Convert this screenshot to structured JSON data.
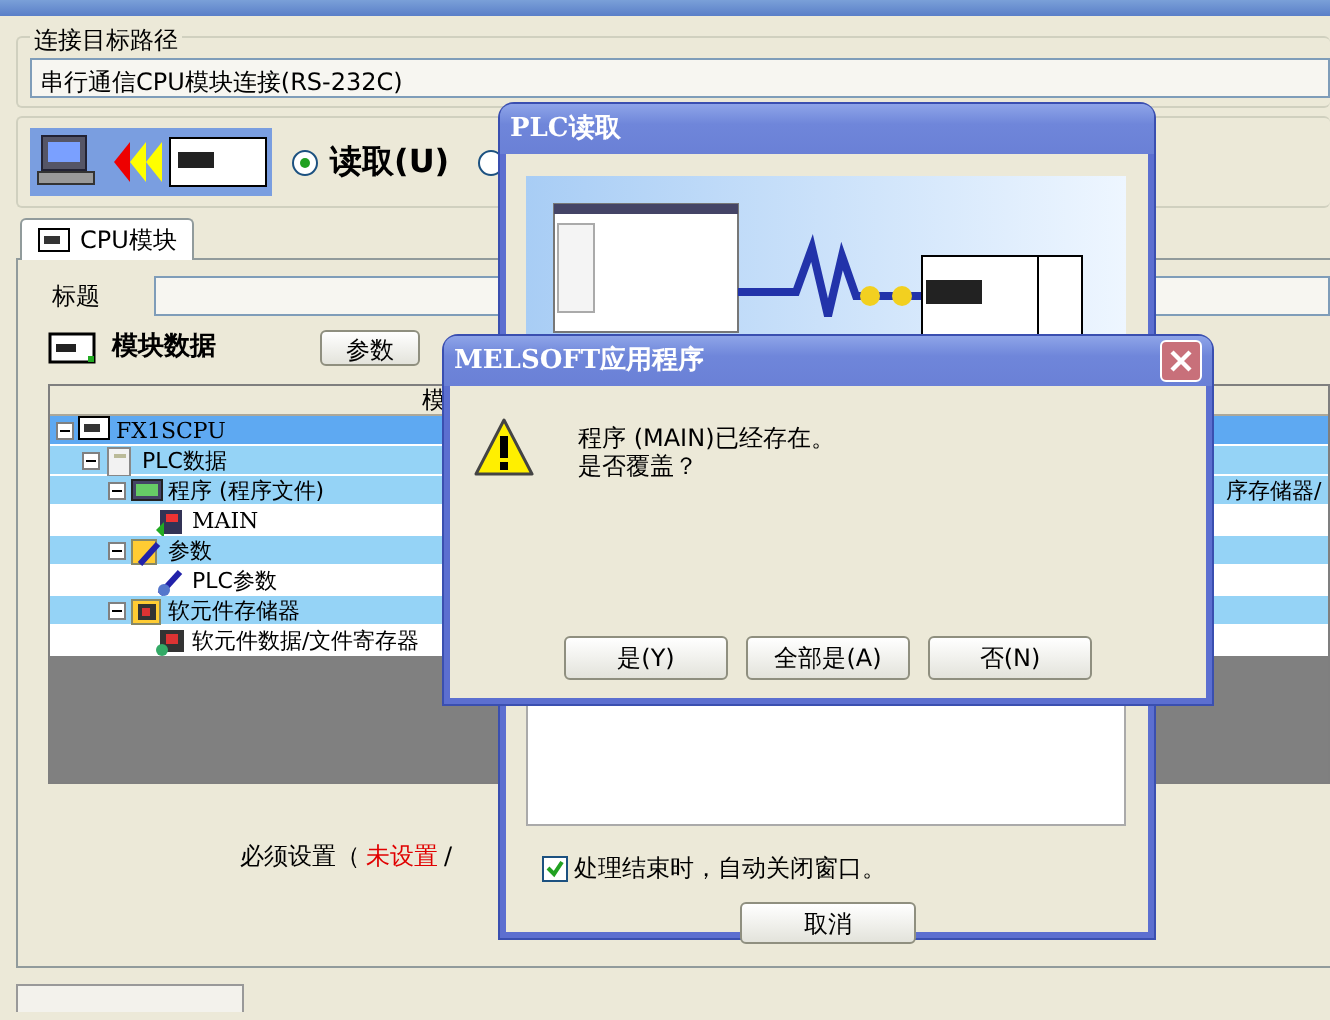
{
  "main_window": {
    "connection_group": {
      "legend": "连接目标路径",
      "value": "串行通信CPU模块连接(RS-232C)"
    },
    "mode_radios": [
      {
        "label": "读取(U)",
        "selected": true
      },
      {
        "selected": false
      }
    ],
    "tabs": [
      {
        "label": "CPU模块",
        "selected": true
      }
    ],
    "title_field": {
      "label": "标题"
    },
    "module_data": {
      "heading": "模块数据",
      "button": "参数"
    },
    "tree": {
      "column_1": "模",
      "items": [
        {
          "label": "FX1SCPU",
          "kind": "cpu",
          "selected": true,
          "children": [
            {
              "label": "PLC数据",
              "kind": "data",
              "selected": false,
              "children": [
                {
                  "label": "程序 (程序文件)",
                  "kind": "program",
                  "selected": false,
                  "column_2": "序存储器/",
                  "children": [
                    {
                      "label": "MAIN",
                      "kind": "file",
                      "selected": false
                    }
                  ]
                },
                {
                  "label": "参数",
                  "kind": "param",
                  "selected": false,
                  "children": [
                    {
                      "label": "PLC参数",
                      "kind": "paramfile",
                      "selected": false
                    }
                  ]
                },
                {
                  "label": "软元件存储器",
                  "kind": "device",
                  "selected": false,
                  "children": [
                    {
                      "label": "软元件数据/文件寄存器",
                      "kind": "devicefile",
                      "selected": false
                    }
                  ]
                }
              ]
            }
          ]
        }
      ]
    },
    "required_note": {
      "prefix": "必须设置（",
      "status": "未设置",
      "suffix": "/"
    }
  },
  "read_dialog": {
    "title": "PLC读取",
    "auto_close": {
      "label": "处理结束时，自动关闭窗口。",
      "checked": true
    },
    "cancel_button": "取消"
  },
  "confirm_dialog": {
    "title": "MELSOFT应用程序",
    "message": [
      "程序 (MAIN)已经存在。",
      "是否覆盖？"
    ],
    "buttons": [
      "是(Y)",
      "全部是(A)",
      "否(N)"
    ]
  }
}
